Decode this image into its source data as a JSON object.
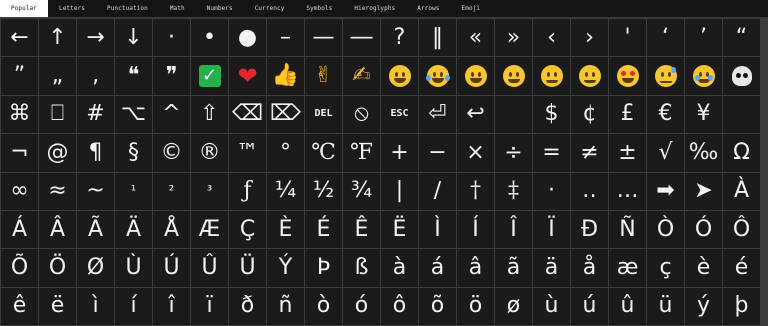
{
  "tabs": [
    "Popular",
    "Letters",
    "Punctuation",
    "Math",
    "Numbers",
    "Currency",
    "Symbols",
    "Hieroglyphs",
    "Arrows",
    "Emoji"
  ],
  "active_tab": "Popular",
  "colors": {
    "check_green": "#22b14c",
    "heart_red": "#e0282e",
    "emoji_yellow": "#f8c630",
    "tab_active_bg": "#ffffff"
  },
  "rows": [
    [
      "←",
      "↑",
      "→",
      "↓",
      "·",
      "•",
      "●",
      "–",
      "—",
      "―",
      "?",
      "‖",
      "«",
      "»",
      "‹",
      "›",
      "'",
      "‘",
      "’",
      "“"
    ],
    [
      "”",
      "„",
      "‚",
      "❝",
      "❞",
      "{check-icon}",
      "{heart-icon}",
      "{thumbs-up-icon}",
      "{victory-hand-icon}",
      "{writing-hand-icon}",
      "{grinning-face-icon}",
      "{joy-face-icon}",
      "{smiley-face-icon}",
      "{grin-face-icon}",
      "{wink-face-icon}",
      "{blush-face-icon}",
      "{heart-eyes-face-icon}",
      "{sweat-face-icon}",
      "{crying-face-icon}",
      "{skull-crossbones-icon}"
    ],
    [
      "⌘",
      "⎕",
      "#",
      "⌥",
      "^",
      "⇧",
      "⌫",
      "⌦",
      "DEL",
      "⦸",
      "ESC",
      "⏎",
      "↩",
      "",
      "$",
      "¢",
      "£",
      "€",
      "¥",
      ""
    ],
    [
      "¬",
      "@",
      "¶",
      "§",
      "©",
      "®",
      "™",
      "°",
      "℃",
      "℉",
      "+",
      "−",
      "×",
      "÷",
      "=",
      "≠",
      "±",
      "√",
      "‰",
      "Ω"
    ],
    [
      "∞",
      "≈",
      "~",
      "¹",
      "²",
      "³",
      "ƒ",
      "¼",
      "½",
      "¾",
      "|",
      "∕",
      "†",
      "‡",
      "·",
      "‥",
      "…",
      "➡",
      "➤",
      "À"
    ],
    [
      "Á",
      "Â",
      "Ã",
      "Ä",
      "Å",
      "Æ",
      "Ç",
      "È",
      "É",
      "Ê",
      "Ë",
      "Ì",
      "Í",
      "Î",
      "Ï",
      "Đ",
      "Ñ",
      "Ò",
      "Ó",
      "Ô"
    ],
    [
      "Õ",
      "Ö",
      "Ø",
      "Ù",
      "Ú",
      "Û",
      "Ü",
      "Ý",
      "Þ",
      "ß",
      "à",
      "á",
      "â",
      "ã",
      "ä",
      "å",
      "æ",
      "ç",
      "è",
      "é"
    ],
    [
      "ê",
      "ë",
      "ì",
      "í",
      "î",
      "ï",
      "ð",
      "ñ",
      "ò",
      "ó",
      "ô",
      "õ",
      "ö",
      "ø",
      "ù",
      "ú",
      "û",
      "ü",
      "ý",
      "þ"
    ]
  ]
}
